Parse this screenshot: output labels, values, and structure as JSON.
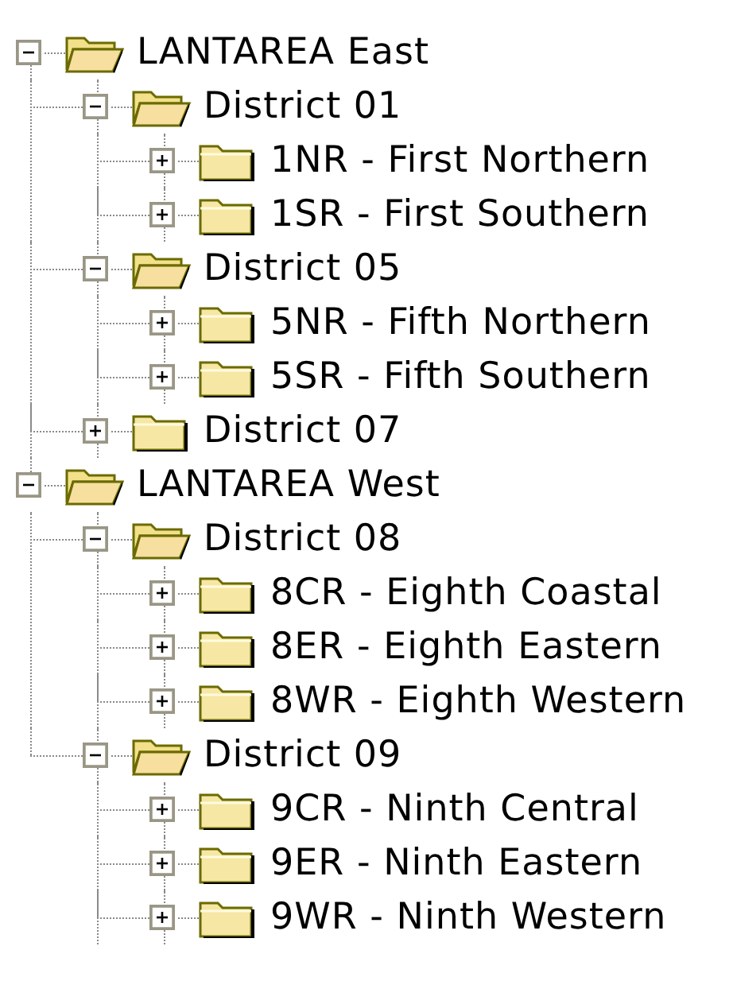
{
  "tree": [
    {
      "label": "LANTAREA East",
      "expanded": true,
      "children": [
        {
          "label": "District 01",
          "expanded": true,
          "children": [
            {
              "label": "1NR - First Northern",
              "expanded": false
            },
            {
              "label": "1SR - First Southern",
              "expanded": false
            }
          ]
        },
        {
          "label": "District 05",
          "expanded": true,
          "children": [
            {
              "label": "5NR - Fifth Northern",
              "expanded": false
            },
            {
              "label": "5SR - Fifth Southern",
              "expanded": false
            }
          ]
        },
        {
          "label": "District 07",
          "expanded": false
        }
      ]
    },
    {
      "label": "LANTAREA West",
      "expanded": true,
      "children": [
        {
          "label": "District 08",
          "expanded": true,
          "children": [
            {
              "label": "8CR - Eighth Coastal",
              "expanded": false
            },
            {
              "label": "8ER - Eighth Eastern",
              "expanded": false
            },
            {
              "label": "8WR - Eighth Western",
              "expanded": false
            }
          ]
        },
        {
          "label": "District 09",
          "expanded": true,
          "children": [
            {
              "label": "9CR - Ninth Central",
              "expanded": false
            },
            {
              "label": "9ER - Ninth Eastern",
              "expanded": false
            },
            {
              "label": "9WR - Ninth Western",
              "expanded": false
            }
          ]
        }
      ]
    }
  ]
}
